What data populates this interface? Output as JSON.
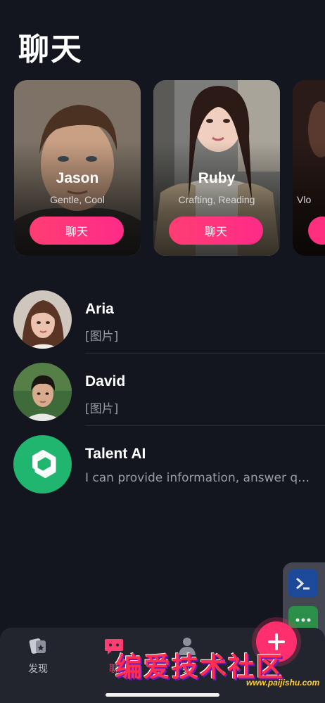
{
  "header": {
    "title": "聊天"
  },
  "featured": [
    {
      "name": "Jason",
      "tags": "Gentle, Cool",
      "button": "聊天"
    },
    {
      "name": "Ruby",
      "tags": "Crafting, Reading",
      "button": "聊天"
    },
    {
      "name": "",
      "tags": "Vlo",
      "button": ""
    }
  ],
  "conversations": [
    {
      "name": "Aria",
      "preview": "[图片]"
    },
    {
      "name": "David",
      "preview": "[图片]"
    },
    {
      "name": "Talent AI",
      "preview": "I can provide information, answer qu..."
    }
  ],
  "nav": {
    "discover": "发现",
    "chat": "聊",
    "me": "我"
  },
  "watermark": {
    "text": "编爱技术社区",
    "url": "www.paijishu.com"
  },
  "colors": {
    "background": "#14161f",
    "accent": "#ff3d73",
    "talent_ai_green": "#21b66f",
    "nav_bg": "#23252e"
  },
  "icons": {
    "discover": "cards-icon",
    "chat": "chat-bubble-icon",
    "me": "person-icon",
    "fab": "plus-icon",
    "terminal": "terminal-icon",
    "more": "more-dots-icon",
    "talent_ai": "openai-logo-icon"
  }
}
